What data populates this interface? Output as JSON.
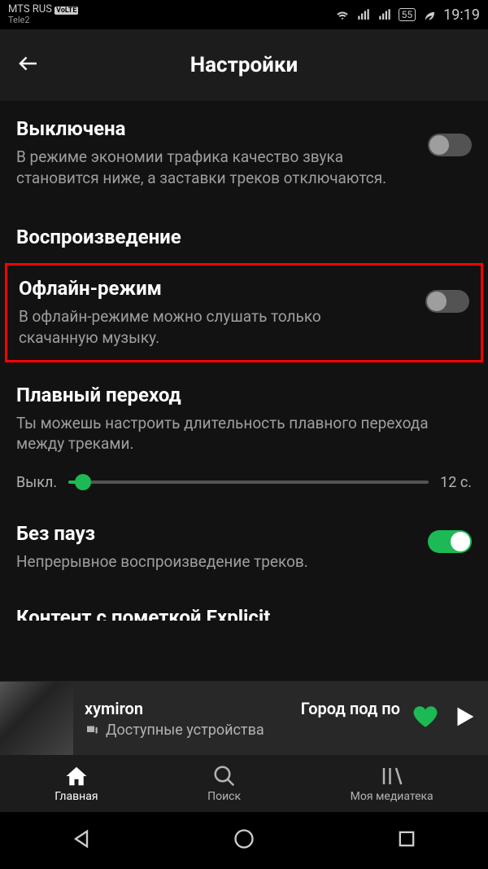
{
  "status_bar": {
    "carrier": "MTS RUS",
    "volte": "VoLTE",
    "subcarrier": "Tele2",
    "battery": "55",
    "time": "19:19"
  },
  "header": {
    "title": "Настройки"
  },
  "settings": {
    "data_saver": {
      "title": "Выключена",
      "desc": "В режиме экономии трафика качество звука становится ниже, а заставки треков отключаются."
    },
    "section_playback": "Воспроизведение",
    "offline": {
      "title": "Офлайн-режим",
      "desc": "В офлайн-режиме можно слушать только скачанную музыку."
    },
    "crossfade": {
      "title": "Плавный переход",
      "desc": "Ты можешь настроить длительность плавного перехода между треками.",
      "min_label": "Выкл.",
      "max_label": "12 с."
    },
    "gapless": {
      "title": "Без пауз",
      "desc": "Непрерывное воспроизведение треков."
    },
    "truncated": "Контент с пометкой Explicit"
  },
  "now_playing": {
    "artist": "xymiron",
    "track": "Город под по",
    "devices": "Доступные устройства"
  },
  "nav": {
    "home": "Главная",
    "search": "Поиск",
    "library": "Моя медиатека"
  }
}
